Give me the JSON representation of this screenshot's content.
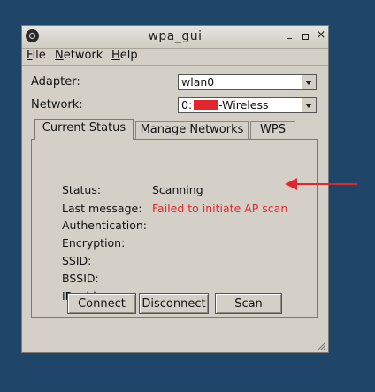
{
  "window": {
    "title": "wpa_gui"
  },
  "menu": {
    "file_rest": "ile",
    "file_u": "F",
    "network_rest": "etwork",
    "network_u": "N",
    "help_rest": "elp",
    "help_u": "H"
  },
  "form": {
    "adapter_label": "Adapter:",
    "adapter_value": "wlan0",
    "network_label": "Network:",
    "network_value_prefix": "0:",
    "network_value_suffix": "-Wireless"
  },
  "tabs": [
    {
      "label": "Current Status",
      "active": true
    },
    {
      "label": "Manage Networks",
      "active": false
    },
    {
      "label": "WPS",
      "active": false
    }
  ],
  "status": {
    "status_label": "Status:",
    "status_value": "Scanning",
    "last_message_label": "Last message:",
    "last_message_value": "Failed to initiate AP scan",
    "authentication_label": "Authentication:",
    "encryption_label": "Encryption:",
    "ssid_label": "SSID:",
    "bssid_label": "BSSID:",
    "ip_label": "IP address:"
  },
  "buttons": {
    "connect": "Connect",
    "disconnect": "Disconnect",
    "scan": "Scan"
  },
  "colors": {
    "desktop": "#1f4568",
    "window_bg": "#d4d0c8",
    "error_text": "#e3262d",
    "annotation_arrow": "#e3262d"
  },
  "icons": {
    "app": "wpa-gui-app-icon",
    "minimize": "minimize-icon",
    "maximize": "maximize-icon",
    "close": "close-icon",
    "dropdown": "chevron-down-icon",
    "resize": "resize-grip-icon",
    "annotation": "red-arrow-annotation"
  }
}
